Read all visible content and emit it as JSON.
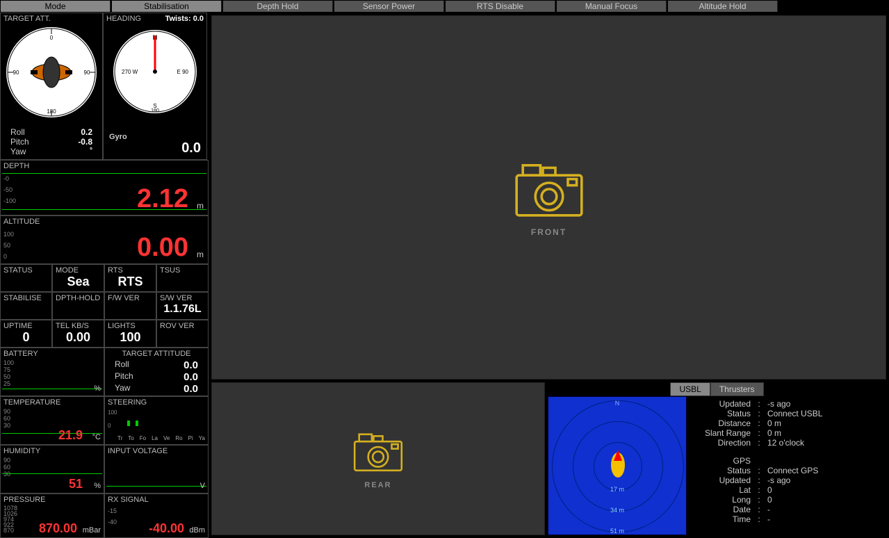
{
  "topbar": {
    "mode": "Mode",
    "stab": "Stabilisation",
    "depth": "Depth Hold",
    "sensor": "Sensor Power",
    "rts": "RTS Disable",
    "focus": "Manual Focus",
    "alt": "Altitude Hold"
  },
  "target_att": {
    "title": "TARGET ATT.",
    "roll_label": "Roll",
    "pitch_label": "Pitch",
    "yaw_label": "Yaw",
    "roll": "0.2",
    "pitch": "-0.8",
    "yaw": "",
    "deg": "°"
  },
  "heading": {
    "title": "HEADING",
    "twists_label": "Twists:",
    "twists": "0.0",
    "gyro": "Gyro",
    "value": "0.0",
    "n": "N",
    "e": "E  90",
    "s": "S",
    "w": "270 W",
    "t180": "180"
  },
  "depth": {
    "title": "DEPTH",
    "value": "2.12",
    "unit": "m",
    "s0": "-0",
    "s50": "-50",
    "s100": "-100"
  },
  "altitude": {
    "title": "ALTITUDE",
    "value": "0.00",
    "unit": "m",
    "s0": "0",
    "s50": "50",
    "s100": "100"
  },
  "status": {
    "status": {
      "lbl": "STATUS",
      "val": ""
    },
    "mode": {
      "lbl": "MODE",
      "val": "Sea"
    },
    "rts": {
      "lbl": "RTS",
      "val": "RTS"
    },
    "tsus": {
      "lbl": "TSUS",
      "val": ""
    },
    "stabilise": {
      "lbl": "STABILISE",
      "val": ""
    },
    "dpthhold": {
      "lbl": "DPTH-HOLD",
      "val": ""
    },
    "fwver": {
      "lbl": "F/W VER",
      "val": ""
    },
    "swver": {
      "lbl": "S/W VER",
      "val": "1.1.76L"
    },
    "uptime": {
      "lbl": "UPTIME",
      "val": "0"
    },
    "telkbs": {
      "lbl": "TEL KB/S",
      "val": "0.00"
    },
    "lights": {
      "lbl": "LIGHTS",
      "val": "100"
    },
    "rovver": {
      "lbl": "ROV VER",
      "val": ""
    }
  },
  "battery": {
    "title": "BATTERY",
    "s100": "100",
    "s75": "75",
    "s50": "50",
    "s25": "25",
    "unit": "%"
  },
  "target_attitude_side": {
    "title": "TARGET ATTITUDE",
    "roll_l": "Roll",
    "pitch_l": "Pitch",
    "yaw_l": "Yaw",
    "roll": "0.0",
    "pitch": "0.0",
    "yaw": "0.0"
  },
  "temperature": {
    "title": "TEMPERATURE",
    "s90": "90",
    "s60": "60",
    "s30": "30",
    "value": "21.9",
    "unit": "°C"
  },
  "steering": {
    "title": "STEERING",
    "s100": "100",
    "s0": "0",
    "l1": "Tr",
    "l2": "To",
    "l3": "Fo",
    "l4": "La",
    "l5": "Ve",
    "l6": "Ro",
    "l7": "Pi",
    "l8": "Ya"
  },
  "humidity": {
    "title": "HUMIDITY",
    "s90": "90",
    "s60": "60",
    "s30": "30",
    "value": "51",
    "unit": "%"
  },
  "input_voltage": {
    "title": "INPUT VOLTAGE",
    "unit": "V"
  },
  "pressure": {
    "title": "PRESSURE",
    "s1078": "1078",
    "s1026": "1026",
    "s974": "974",
    "s922": "922",
    "s870": "870",
    "value": "870.00",
    "unit": "mBar"
  },
  "rx": {
    "title": "RX SIGNAL",
    "s15": "-15",
    "s40": "-40",
    "value": "-40.00",
    "unit": "dBm"
  },
  "views": {
    "front": "FRONT",
    "rear": "REAR"
  },
  "usbl_tabs": {
    "usbl": "USBL",
    "thrusters": "Thrusters"
  },
  "sonar": {
    "n": "N",
    "r1": "17 m",
    "r2": "34 m",
    "r3": "51 m"
  },
  "info": {
    "updated_l": "Updated",
    "updated_v": "-s ago",
    "status_l": "Status",
    "status_v": "Connect USBL",
    "distance_l": "Distance",
    "distance_v": "0 m",
    "slant_l": "Slant Range",
    "slant_v": "0 m",
    "direction_l": "Direction",
    "direction_v": "12 o'clock",
    "gps_h": "GPS",
    "gps_status_l": "Status",
    "gps_status_v": "Connect GPS",
    "gps_updated_l": "Updated",
    "gps_updated_v": "-s ago",
    "lat_l": "Lat",
    "lat_v": "0",
    "long_l": "Long",
    "long_v": "0",
    "date_l": "Date",
    "date_v": "-",
    "time_l": "Time",
    "time_v": "-"
  }
}
